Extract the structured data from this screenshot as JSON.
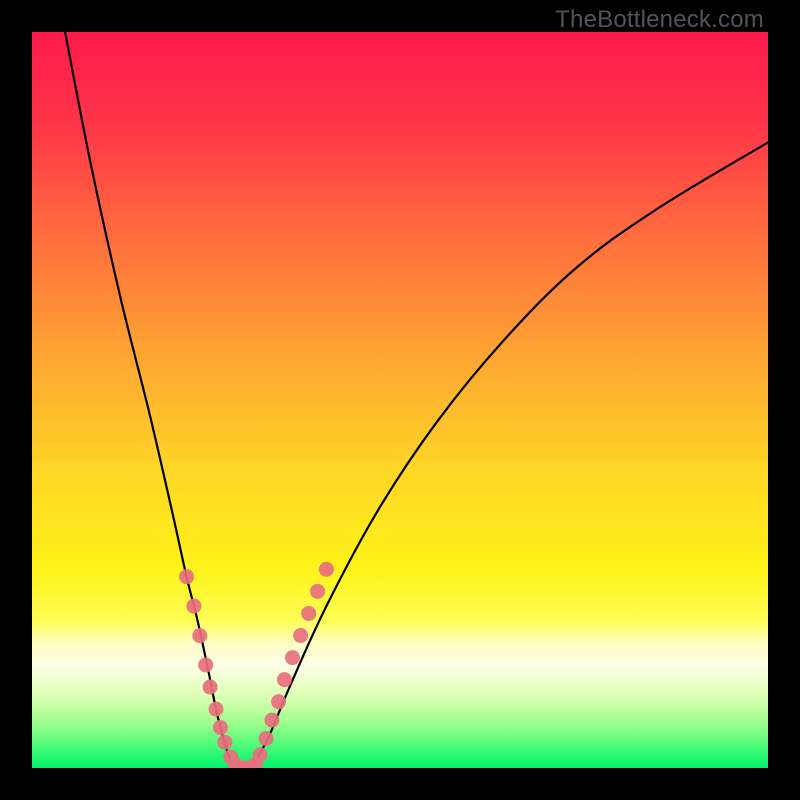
{
  "watermark": "TheBottleneck.com",
  "chart_data": {
    "type": "line",
    "title": "",
    "xlabel": "",
    "ylabel": "",
    "xlim": [
      0,
      100
    ],
    "ylim": [
      0,
      100
    ],
    "grid": false,
    "background_gradient_stops": [
      {
        "offset": 0.0,
        "color": "#ff1a4b"
      },
      {
        "offset": 0.12,
        "color": "#ff3348"
      },
      {
        "offset": 0.27,
        "color": "#ff6a3e"
      },
      {
        "offset": 0.43,
        "color": "#ffa233"
      },
      {
        "offset": 0.6,
        "color": "#ffd726"
      },
      {
        "offset": 0.73,
        "color": "#fff319"
      },
      {
        "offset": 0.8,
        "color": "#fffe56"
      },
      {
        "offset": 0.83,
        "color": "#fffec1"
      },
      {
        "offset": 0.86,
        "color": "#fdffe6"
      },
      {
        "offset": 0.905,
        "color": "#d9ffb1"
      },
      {
        "offset": 0.94,
        "color": "#9cfd8c"
      },
      {
        "offset": 0.97,
        "color": "#4dfa78"
      },
      {
        "offset": 1.0,
        "color": "#00f36b"
      }
    ],
    "series": [
      {
        "name": "left-curve",
        "x": [
          4.5,
          8.0,
          12.0,
          16.0,
          19.0,
          21.0,
          22.5,
          24.0,
          25.0,
          26.0,
          27.0,
          28.0
        ],
        "y": [
          100,
          82,
          64,
          48,
          35,
          26,
          20,
          13,
          8,
          4,
          1,
          0
        ]
      },
      {
        "name": "right-curve",
        "x": [
          30.0,
          31.0,
          32.5,
          35.0,
          40.0,
          47.0,
          55.0,
          64.0,
          74.0,
          85.0,
          100.0
        ],
        "y": [
          0,
          2,
          5,
          11,
          22,
          35,
          47,
          58,
          68,
          76,
          85
        ]
      }
    ],
    "markers": {
      "name": "highlight-markers",
      "color": "#e86f7e",
      "points": [
        {
          "x": 21.0,
          "y": 26
        },
        {
          "x": 22.0,
          "y": 22
        },
        {
          "x": 22.8,
          "y": 18
        },
        {
          "x": 23.6,
          "y": 14
        },
        {
          "x": 24.2,
          "y": 11
        },
        {
          "x": 25.0,
          "y": 8
        },
        {
          "x": 25.6,
          "y": 5.5
        },
        {
          "x": 26.2,
          "y": 3.5
        },
        {
          "x": 27.0,
          "y": 1.5
        },
        {
          "x": 27.6,
          "y": 0.5
        },
        {
          "x": 28.3,
          "y": 0
        },
        {
          "x": 29.0,
          "y": 0
        },
        {
          "x": 29.7,
          "y": 0
        },
        {
          "x": 30.4,
          "y": 0.5
        },
        {
          "x": 31.0,
          "y": 1.8
        },
        {
          "x": 31.8,
          "y": 4
        },
        {
          "x": 32.6,
          "y": 6.5
        },
        {
          "x": 33.5,
          "y": 9
        },
        {
          "x": 34.3,
          "y": 12
        },
        {
          "x": 35.4,
          "y": 15
        },
        {
          "x": 36.5,
          "y": 18
        },
        {
          "x": 37.6,
          "y": 21
        },
        {
          "x": 38.8,
          "y": 24
        },
        {
          "x": 40.0,
          "y": 27
        }
      ]
    }
  }
}
